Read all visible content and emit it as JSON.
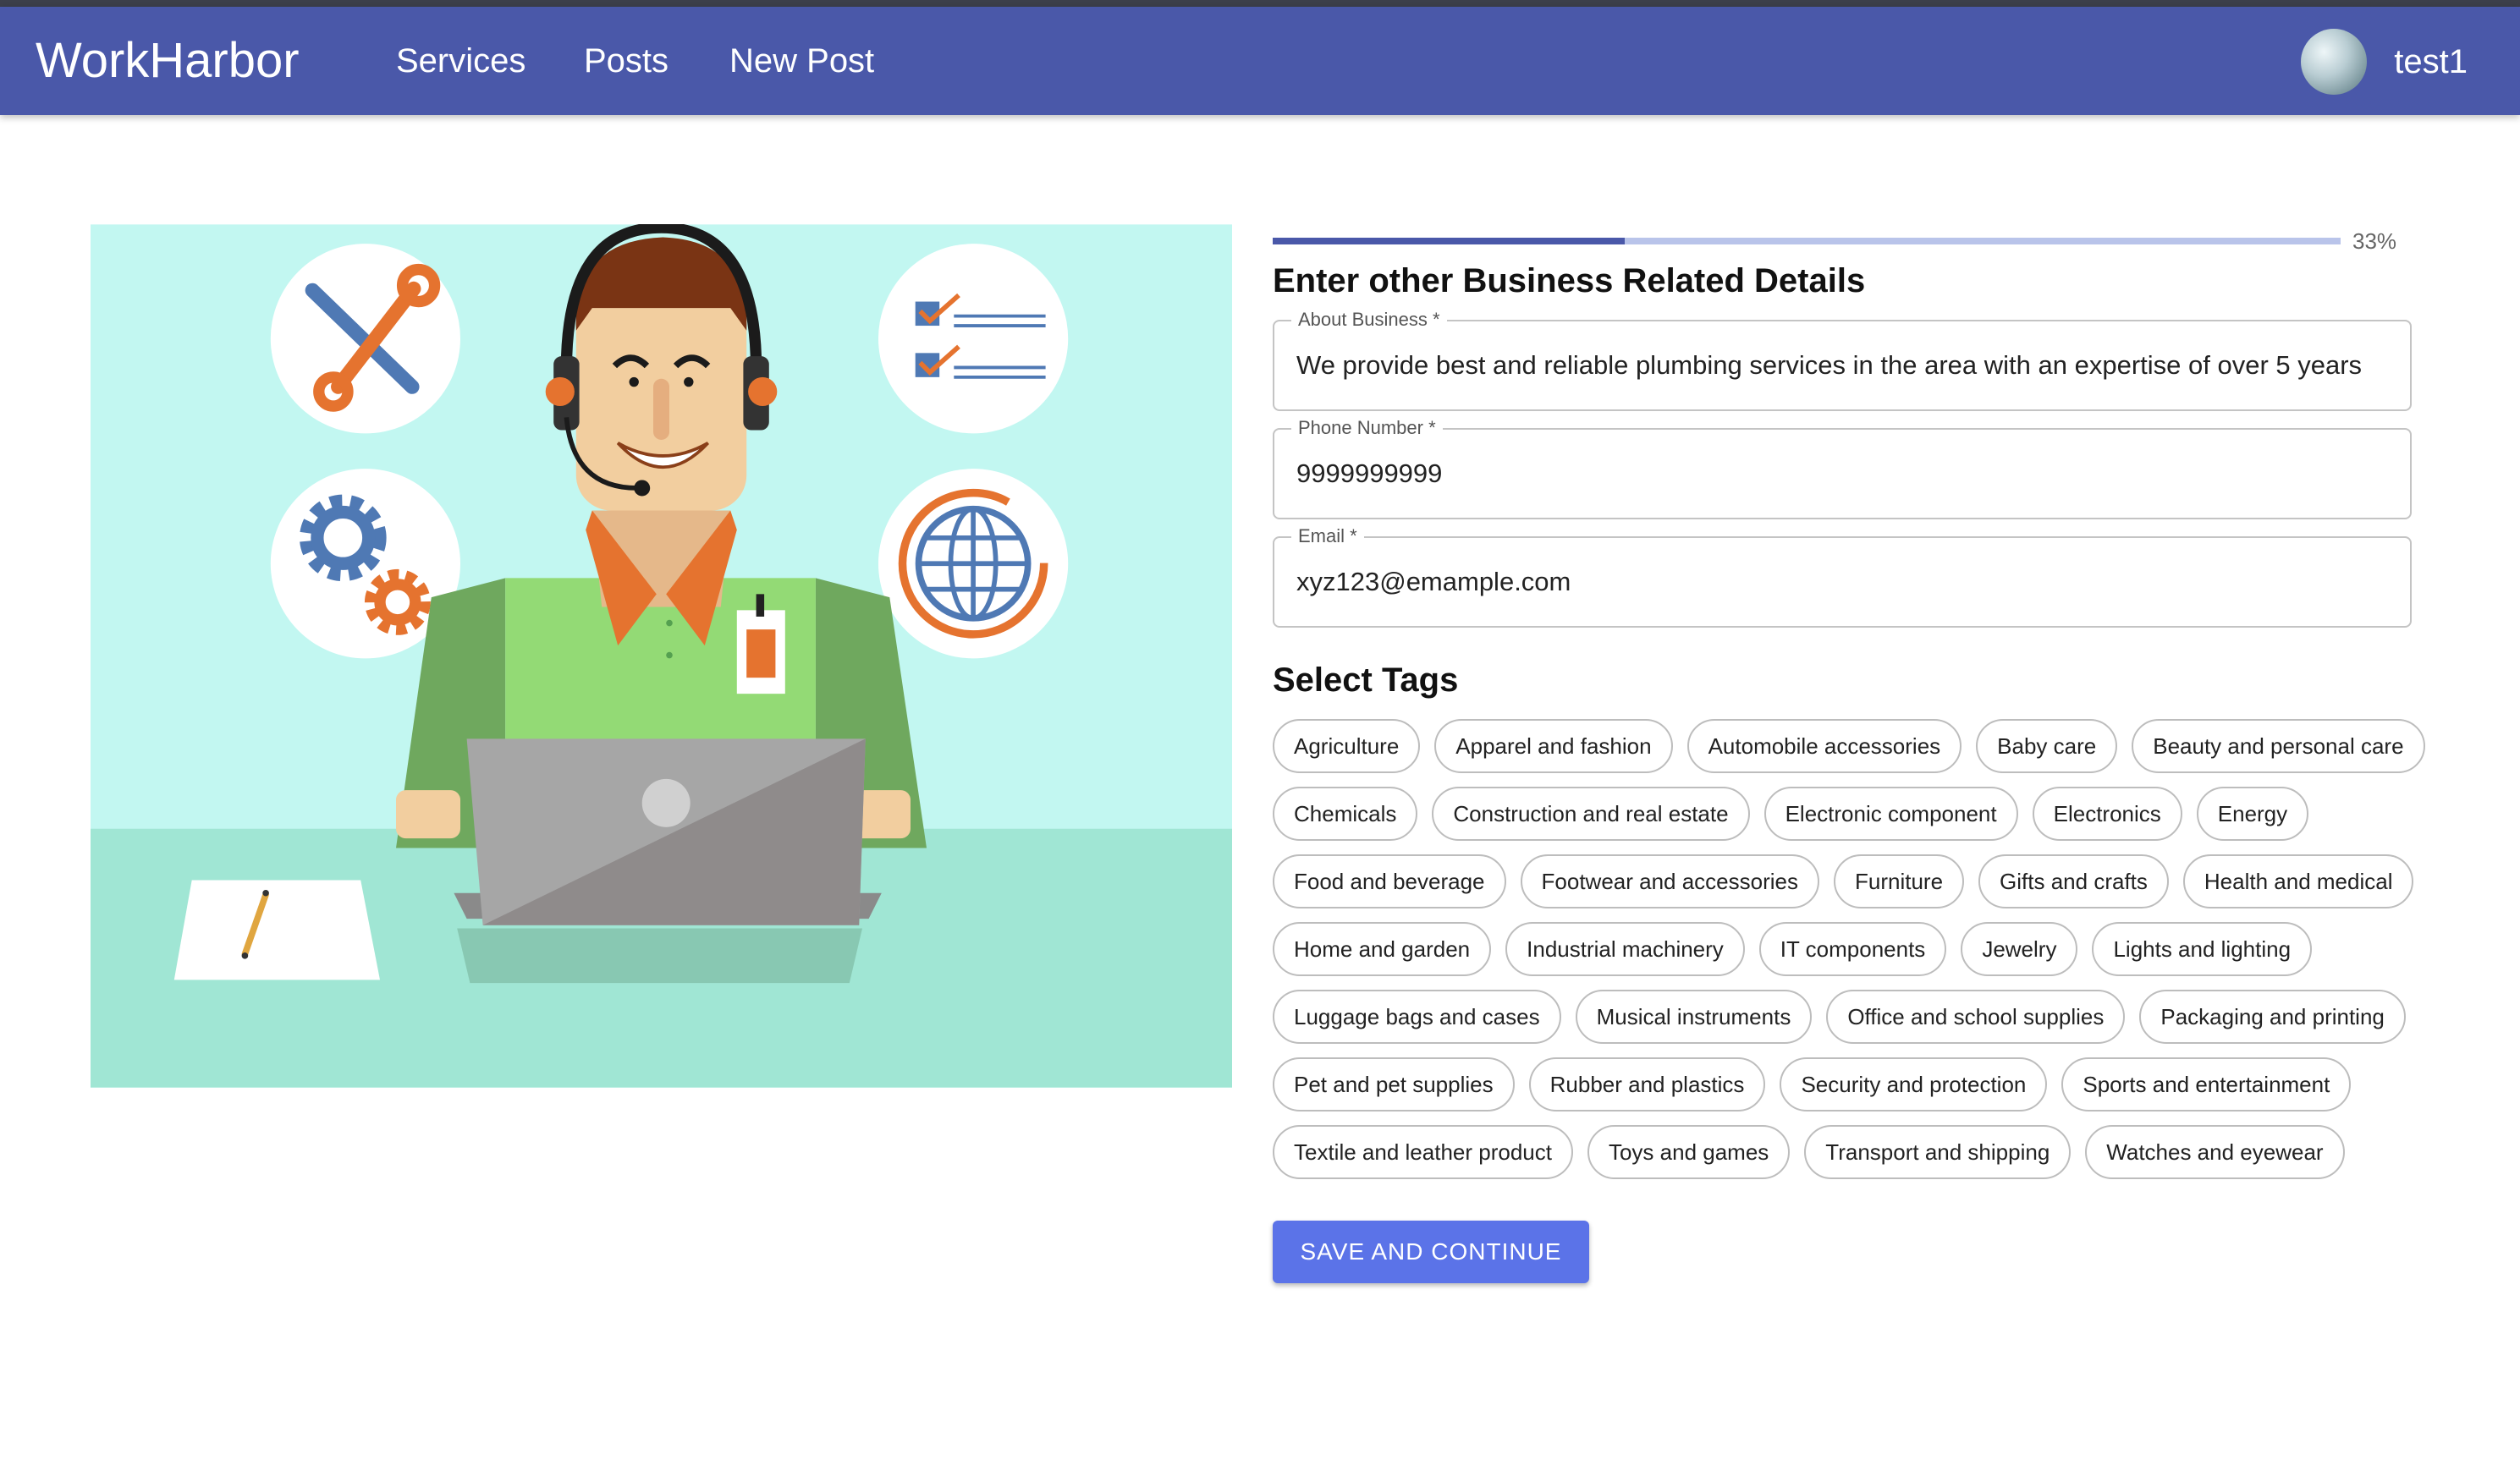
{
  "header": {
    "brand": "WorkHarbor",
    "nav": [
      "Services",
      "Posts",
      "New Post"
    ],
    "username": "test1"
  },
  "progress": {
    "value": 0.33,
    "label": "33%"
  },
  "form": {
    "title": "Enter other Business Related Details",
    "about": {
      "label": "About Business *",
      "value": "We provide best and reliable plumbing services in the area with an expertise of over 5 years"
    },
    "phone": {
      "label": "Phone Number *",
      "value": "9999999999"
    },
    "email": {
      "label": "Email *",
      "value": "xyz123@emample.com"
    }
  },
  "tags_section": {
    "title": "Select Tags",
    "rows": [
      [
        "Agriculture",
        "Apparel and fashion",
        "Automobile accessories",
        "Baby care",
        "Beauty and personal care"
      ],
      [
        "Chemicals",
        "Construction and real estate",
        "Electronic component",
        "Electronics",
        "Energy"
      ],
      [
        "Food and beverage",
        "Footwear and accessories",
        "Furniture",
        "Gifts and crafts",
        "Health and medical"
      ],
      [
        "Home and garden",
        "Industrial machinery",
        "IT components",
        "Jewelry",
        "Lights and lighting"
      ],
      [
        "Luggage bags and cases",
        "Musical instruments",
        "Office and school supplies",
        "Packaging and printing"
      ],
      [
        "Pet and pet supplies",
        "Rubber and plastics",
        "Security and protection",
        "Sports and entertainment"
      ],
      [
        "Textile and leather product",
        "Toys and games",
        "Transport and shipping",
        "Watches and eyewear"
      ]
    ]
  },
  "save_button": "SAVE AND CONTINUE",
  "icons": [
    "tools-icon",
    "checklist-icon",
    "gears-icon",
    "globe-icon",
    "headset-icon",
    "laptop-icon",
    "pencil-icon"
  ],
  "colors": {
    "appbar": "#4a58a9",
    "progress_fill": "#4a58a9",
    "progress_track": "#b9c4ea",
    "button": "#5b73e8",
    "illustration_sky": "#c2f7f1",
    "illustration_floor": "#a0e6d4",
    "accent_orange": "#e5732f",
    "accent_blue": "#4f79b4"
  }
}
